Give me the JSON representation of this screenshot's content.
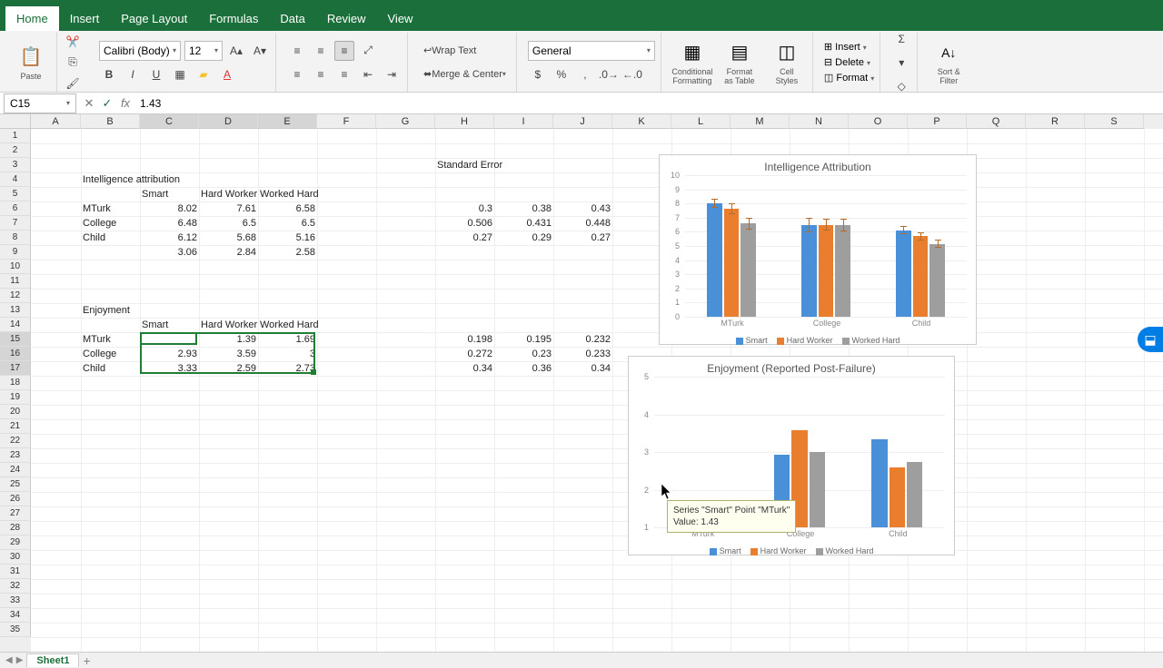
{
  "tabs": [
    "Home",
    "Insert",
    "Page Layout",
    "Formulas",
    "Data",
    "Review",
    "View"
  ],
  "font": {
    "name": "Calibri (Body)",
    "size": "12"
  },
  "number_format": "General",
  "name_box": "C15",
  "formula": "1.43",
  "ribbon": {
    "paste": "Paste",
    "wrap": "Wrap Text",
    "merge": "Merge & Center",
    "cond": "Conditional\nFormatting",
    "fmt_tbl": "Format\nas Table",
    "styles": "Cell\nStyles",
    "insert": "Insert",
    "delete": "Delete",
    "format": "Format",
    "sortfilter": "Sort &\nFilter"
  },
  "col_letters": [
    "A",
    "B",
    "C",
    "D",
    "E",
    "F",
    "G",
    "H",
    "I",
    "J",
    "K",
    "L",
    "M",
    "N",
    "O",
    "P",
    "Q",
    "R",
    "S"
  ],
  "cells": {
    "H3": "Standard Error",
    "B4": "Intelligence attribution",
    "B5_s": "",
    "C5": "Smart",
    "D5": "Hard Worker",
    "E5": "Worked Hard",
    "B6": "MTurk",
    "C6": "8.02",
    "D6": "7.61",
    "E6": "6.58",
    "H6": "0.3",
    "I6": "0.38",
    "J6": "0.43",
    "B7": "College",
    "C7": "6.48",
    "D7": "6.5",
    "E7": "6.5",
    "H7": "0.506",
    "I7": "0.431",
    "J7": "0.448",
    "B8": "Child",
    "C8": "6.12",
    "D8": "5.68",
    "E8": "5.16",
    "H8": "0.27",
    "I8": "0.29",
    "J8": "0.27",
    "C9": "3.06",
    "D9": "2.84",
    "E9": "2.58",
    "B13": "Enjoyment",
    "C14": "Smart",
    "D14": "Hard Worker",
    "E14": "Worked Hard",
    "B15": "MTurk",
    "C15": "1.43",
    "D15": "1.39",
    "E15": "1.69",
    "H15": "0.198",
    "I15": "0.195",
    "J15": "0.232",
    "B16": "College",
    "C16": "2.93",
    "D16": "3.59",
    "E16": "3",
    "H16": "0.272",
    "I16": "0.23",
    "J16": "0.233",
    "B17": "Child",
    "C17": "3.33",
    "D17": "2.59",
    "E17": "2.73",
    "H17": "0.34",
    "I17": "0.36",
    "J17": "0.34"
  },
  "chart_data": [
    {
      "type": "bar",
      "title": "Intelligence Attribution",
      "categories": [
        "MTurk",
        "College",
        "Child"
      ],
      "series": [
        {
          "name": "Smart",
          "values": [
            8.02,
            6.48,
            6.12
          ],
          "err": [
            0.3,
            0.506,
            0.27
          ],
          "color": "#4a90d9"
        },
        {
          "name": "Hard Worker",
          "values": [
            7.61,
            6.5,
            5.68
          ],
          "err": [
            0.38,
            0.431,
            0.29
          ],
          "color": "#e97f2e"
        },
        {
          "name": "Worked Hard",
          "values": [
            6.58,
            6.5,
            5.16
          ],
          "err": [
            0.43,
            0.448,
            0.27
          ],
          "color": "#9e9e9e"
        }
      ],
      "ylim": [
        0,
        10
      ],
      "yticks": [
        0,
        1,
        2,
        3,
        4,
        5,
        6,
        7,
        8,
        9,
        10
      ]
    },
    {
      "type": "bar",
      "title": "Enjoyment (Reported Post-Failure)",
      "categories": [
        "MTurk",
        "College",
        "Child"
      ],
      "series": [
        {
          "name": "Smart",
          "values": [
            1.43,
            2.93,
            3.33
          ],
          "color": "#4a90d9"
        },
        {
          "name": "Hard Worker",
          "values": [
            1.39,
            3.59,
            2.59
          ],
          "color": "#e97f2e"
        },
        {
          "name": "Worked Hard",
          "values": [
            1.69,
            3,
            2.73
          ],
          "color": "#9e9e9e"
        }
      ],
      "ylim": [
        1,
        5
      ],
      "yticks": [
        1,
        2,
        3,
        4,
        5
      ]
    }
  ],
  "tooltip": {
    "line1": "Series \"Smart\" Point \"MTurk\"",
    "line2": "Value: 1.43"
  },
  "sheet_tab": "Sheet1"
}
